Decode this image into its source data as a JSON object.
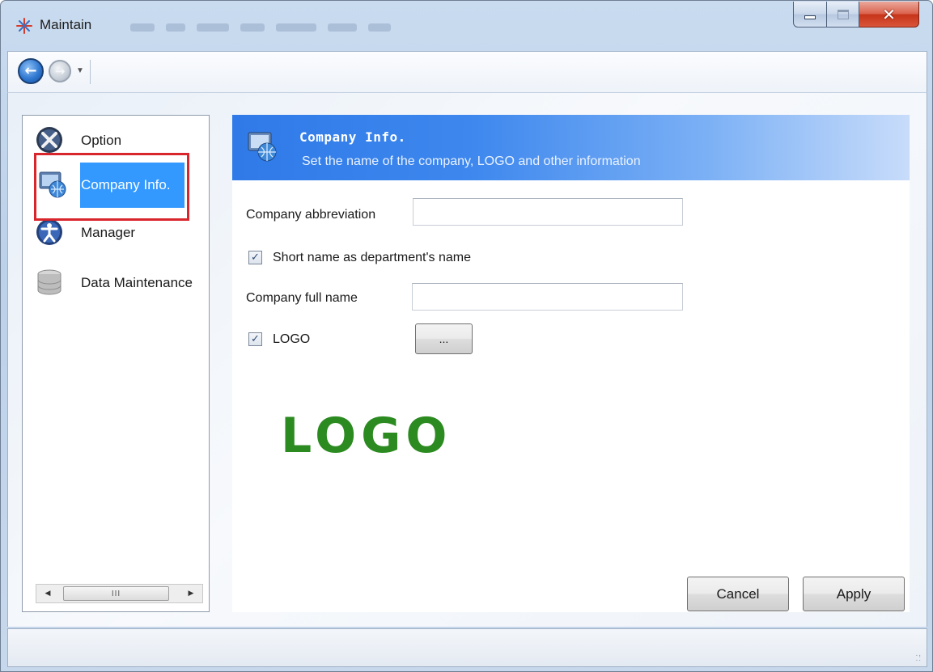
{
  "window": {
    "title": "Maintain",
    "title_icon": "app-star-icon",
    "caption_buttons": [
      "minimize",
      "maximize",
      "close"
    ]
  },
  "navbar": {
    "back_icon": "back-arrow-icon",
    "forward_icon": "forward-arrow-icon",
    "history_dropdown_icon": "chevron-down-icon"
  },
  "sidebar": {
    "items": [
      {
        "label": "Option",
        "icon": "tools-icon"
      },
      {
        "label": "Company Info.",
        "icon": "monitor-globe-icon",
        "selected": true
      },
      {
        "label": "Manager",
        "icon": "person-icon"
      },
      {
        "label": "Data Maintenance",
        "icon": "database-icon"
      }
    ],
    "scrollbar_thumb_glyph": "III",
    "highlight_color": "#3399ff",
    "outline_color": "#d8262c"
  },
  "header": {
    "title": "Company Info.",
    "subtitle": "Set the name of the company, LOGO and other information",
    "icon": "monitor-globe-icon"
  },
  "form": {
    "abbreviation_label": "Company abbreviation",
    "abbreviation_value": "",
    "short_name_checkbox_label": "Short name as department's name",
    "short_name_checked": true,
    "full_name_label": "Company full name",
    "full_name_value": "",
    "logo_checkbox_label": "LOGO",
    "logo_checked": true,
    "browse_button_label": "...",
    "logo_image_text": "LOGO",
    "logo_color": "#2b8a20"
  },
  "actions": {
    "cancel_label": "Cancel",
    "apply_label": "Apply"
  }
}
